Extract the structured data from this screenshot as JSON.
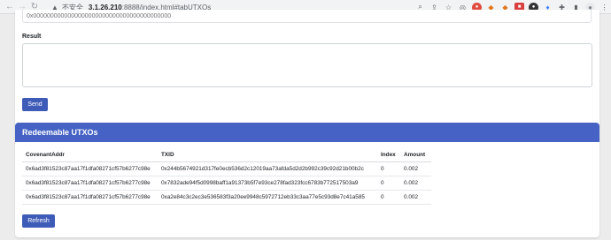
{
  "browser": {
    "insecure_label": "不安全",
    "url_host": "3.1.26.210",
    "url_path": ":8888/index.html#tabUTXOs"
  },
  "form": {
    "address_placeholder": "0x0000000000000000000000000000000000000000",
    "result_label": "Result",
    "result_value": "",
    "send_label": "Send"
  },
  "utxos": {
    "title": "Redeemable UTXOs",
    "columns": [
      "CovenantAddr",
      "TXID",
      "Index",
      "Amount"
    ],
    "rows": [
      [
        "0x6ad3f81523c87aa17f1dfa08271cf57b6277c98e",
        "0x244b5674921d317fe0ecb536d2c12019aa73afda5d2d2b992c39c92d21b00b2c",
        "0",
        "0.002"
      ],
      [
        "0x6ad3f81523c87aa17f1dfa08271cf57b6277c98e",
        "0x7832ade94f5d0998baff1a91373b5f7e93ce278fad323fcc6783b772517503a9",
        "0",
        "0.002"
      ],
      [
        "0x6ad3f81523c87aa17f1dfa08271cf57b6277c98e",
        "0xa2e84c3c2ec3e536583f3a20ee9948c5972712eb33c3aa77e5c93d8e7c41a585",
        "0",
        "0.002"
      ]
    ],
    "refresh_label": "Refresh"
  },
  "icons": {
    "back": "arrow-left-icon",
    "forward": "arrow-right-icon",
    "reload": "reload-icon",
    "warning": "warning-icon"
  }
}
